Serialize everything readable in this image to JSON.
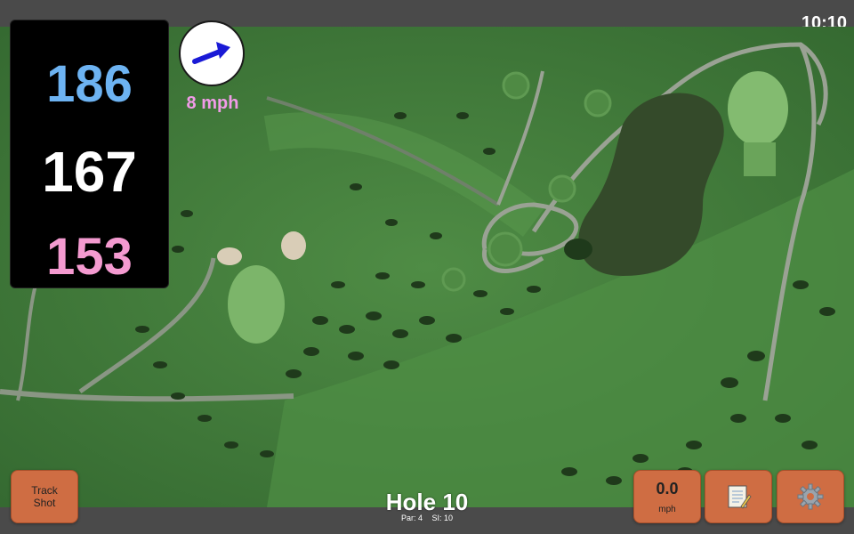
{
  "status": {
    "time": "10:10"
  },
  "distances": {
    "back": {
      "value": "186",
      "color": "#6db3f2"
    },
    "middle": {
      "value": "167",
      "color": "#ffffff"
    },
    "front": {
      "value": "153",
      "color": "#f49ad0"
    }
  },
  "wind": {
    "speed_label": "8 mph",
    "arrow_icon": "wind-arrow-icon",
    "arrow_color": "#1a1ad6"
  },
  "hole": {
    "title": "Hole 10",
    "par_label": "Par: 4",
    "si_label": "SI: 10"
  },
  "buttons": {
    "track_shot": "Track Shot",
    "speed_value": "0.0",
    "speed_unit": "mph",
    "notes_icon": "notepad-icon",
    "settings_icon": "gear-icon",
    "accent": "#cf6d43"
  }
}
